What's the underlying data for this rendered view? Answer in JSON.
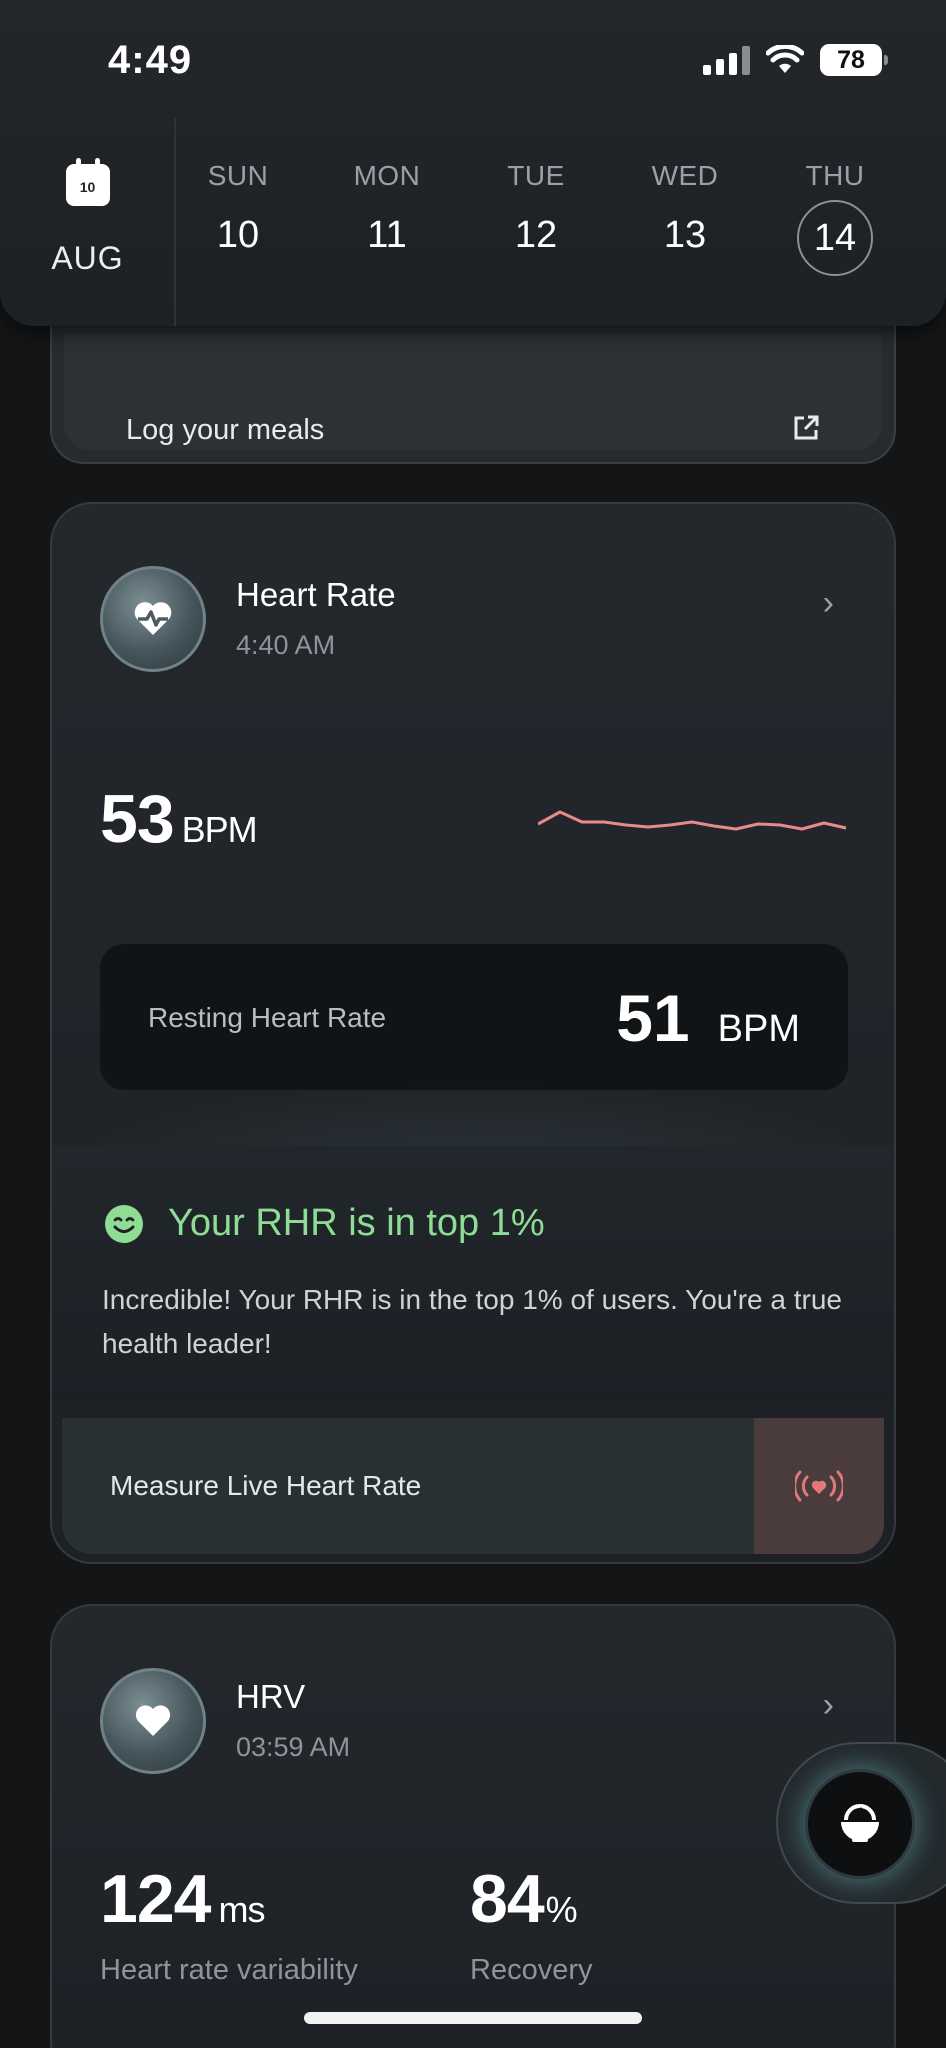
{
  "status_bar": {
    "time": "4:49",
    "battery": "78"
  },
  "header": {
    "month": "AUG",
    "calendar_icon_day": "10",
    "days": [
      {
        "name": "SUN",
        "number": "10"
      },
      {
        "name": "MON",
        "number": "11"
      },
      {
        "name": "TUE",
        "number": "12"
      },
      {
        "name": "WED",
        "number": "13"
      },
      {
        "name": "THU",
        "number": "14",
        "selected": true
      }
    ]
  },
  "meal_card": {
    "label": "Log your meals"
  },
  "heart_rate": {
    "title": "Heart Rate",
    "time": "4:40 AM",
    "value": "53",
    "unit": "BPM",
    "sparkline_color": "#e88a8a",
    "resting": {
      "label": "Resting Heart Rate",
      "value": "51",
      "unit": "BPM"
    },
    "insight_title": "Your RHR is in top 1%",
    "insight_text": "Incredible! Your RHR is in the top 1% of users. You're a true health leader!",
    "insight_color": "#8fdc95",
    "measure_label": "Measure Live Heart Rate"
  },
  "hrv": {
    "title": "HRV",
    "time": "03:59 AM",
    "value": "124",
    "value_unit": "ms",
    "value_label": "Heart rate variability",
    "recovery": "84",
    "recovery_unit": "%",
    "recovery_label": "Recovery"
  },
  "icons": {
    "calendar": "calendar-icon",
    "external_link": "external-link-icon",
    "heart_pulse": "heart-pulse-icon",
    "heart": "heart-icon",
    "smile": "smile-icon",
    "live_signal": "live-heart-signal-icon",
    "meal_bowl": "meal-bowl-icon"
  }
}
